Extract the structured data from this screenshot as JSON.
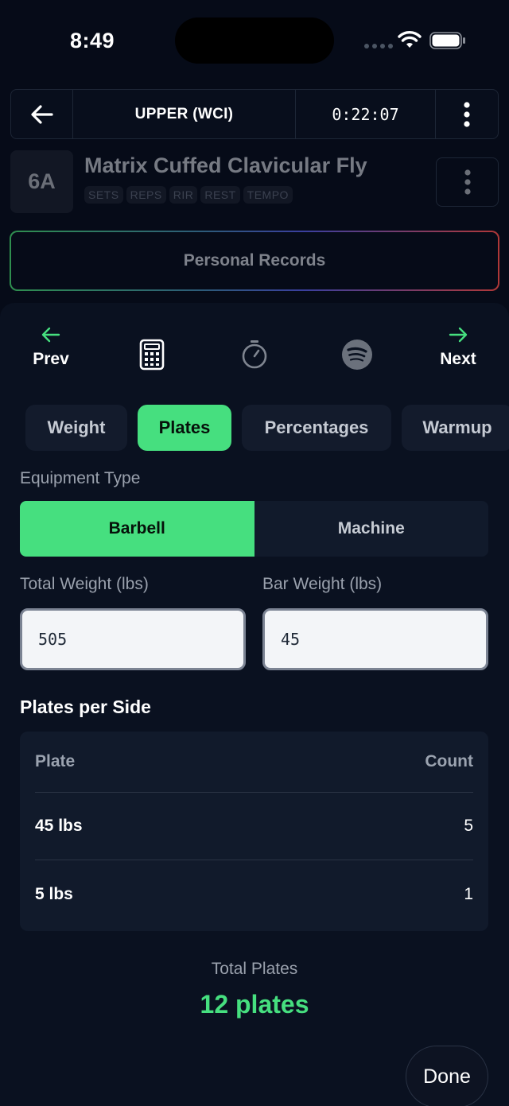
{
  "status_bar": {
    "time": "8:49"
  },
  "header": {
    "title": "UPPER (WCI)",
    "timer": "0:22:07"
  },
  "exercise": {
    "badge": "6A",
    "name": "Matrix Cuffed Clavicular Fly",
    "tags": [
      "SETS",
      "REPS",
      "RIR",
      "REST",
      "TEMPO"
    ],
    "personal_records_label": "Personal Records"
  },
  "toolbar": {
    "prev_label": "Prev",
    "next_label": "Next",
    "icons": [
      "calculator-icon",
      "stopwatch-icon",
      "spotify-icon"
    ]
  },
  "tabs": [
    {
      "label": "Weight",
      "active": false
    },
    {
      "label": "Plates",
      "active": true
    },
    {
      "label": "Percentages",
      "active": false
    },
    {
      "label": "Warmup",
      "active": false
    }
  ],
  "equipment": {
    "label": "Equipment Type",
    "options": [
      {
        "label": "Barbell",
        "active": true
      },
      {
        "label": "Machine",
        "active": false
      }
    ]
  },
  "inputs": {
    "total_weight_label": "Total Weight (lbs)",
    "total_weight_value": "505",
    "bar_weight_label": "Bar Weight (lbs)",
    "bar_weight_value": "45"
  },
  "plates": {
    "title": "Plates per Side",
    "columns": [
      "Plate",
      "Count"
    ],
    "rows": [
      {
        "plate": "45 lbs",
        "count": "5"
      },
      {
        "plate": "5 lbs",
        "count": "1"
      }
    ]
  },
  "totals": {
    "label": "Total Plates",
    "value": "12 plates"
  },
  "done_label": "Done",
  "colors": {
    "accent": "#46df7f",
    "background": "#060b18",
    "card": "#111a2b"
  }
}
